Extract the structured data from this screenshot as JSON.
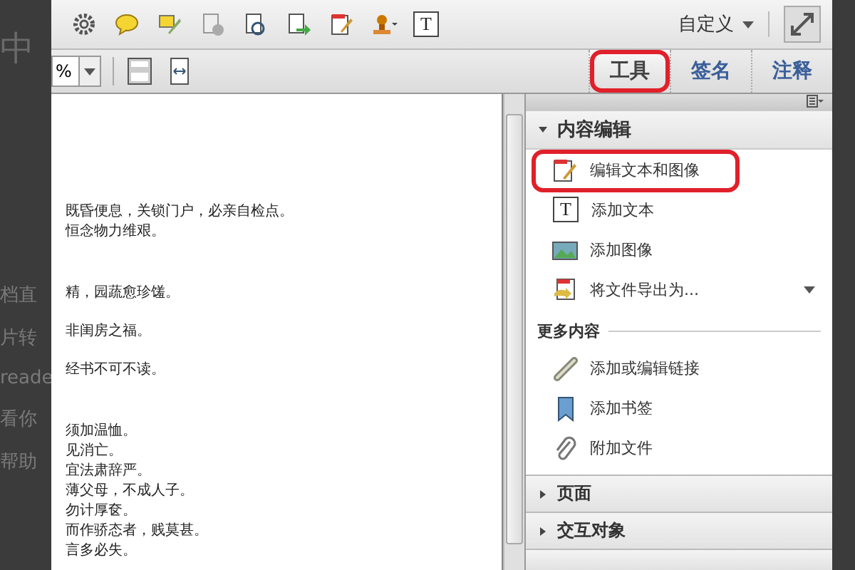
{
  "background_fragments": [
    "中",
    "档直",
    "片转",
    "reade",
    "看你",
    "帮助"
  ],
  "toolbar": {
    "text_tool_glyph": "T",
    "customize": "自定义"
  },
  "nav_toolbar": {
    "zoom_value": "%"
  },
  "tabs": [
    {
      "label": "工具",
      "selected": true,
      "highlighted": true
    },
    {
      "label": "签名",
      "selected": false,
      "highlighted": false
    },
    {
      "label": "注释",
      "selected": false,
      "highlighted": false
    }
  ],
  "document": {
    "lines": [
      "既昏便息，关锁门户，必亲自检点。",
      "恒念物力维艰。",
      "精，园蔬愈珍馐。",
      "非闺房之福。",
      "经书不可不读。",
      "须加温恤。",
      "见消亡。",
      "宜法肃辞严。",
      "薄父母，不成人子。",
      "勿计厚奁。",
      "而作骄态者，贱莫甚。",
      "言多必失。"
    ]
  },
  "panel": {
    "section": {
      "title": "内容编辑",
      "expanded": true
    },
    "items": [
      {
        "label": "编辑文本和图像",
        "highlighted": true,
        "has_menu": false
      },
      {
        "label": "添加文本",
        "glyph": "T",
        "highlighted": false,
        "has_menu": false
      },
      {
        "label": "添加图像",
        "highlighted": false,
        "has_menu": false
      },
      {
        "label": "将文件导出为...",
        "highlighted": false,
        "has_menu": true
      }
    ],
    "more_title": "更多内容",
    "more_items": [
      {
        "label": "添加或编辑链接"
      },
      {
        "label": "添加书签"
      },
      {
        "label": "附加文件"
      }
    ],
    "collapsed_sections": [
      {
        "title": "页面",
        "expanded": false
      },
      {
        "title": "交互对象",
        "expanded": false
      }
    ]
  }
}
